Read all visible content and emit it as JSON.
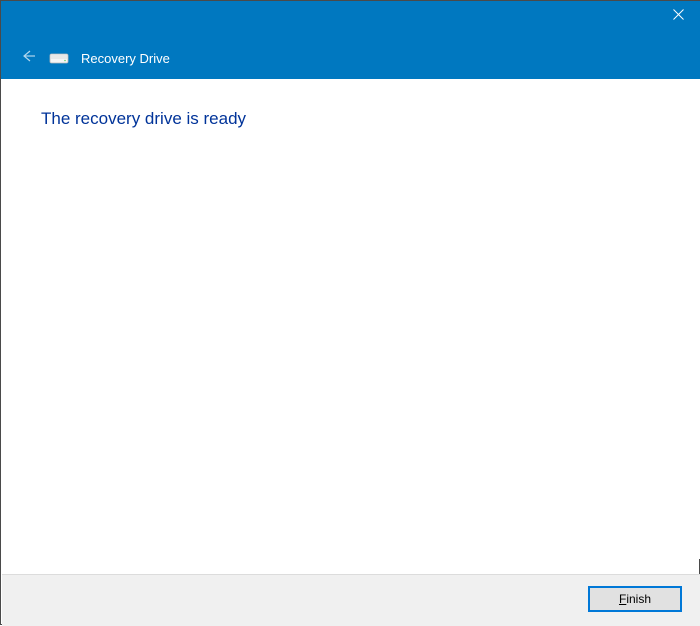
{
  "window": {
    "title": "Recovery Drive"
  },
  "content": {
    "heading": "The recovery drive is ready"
  },
  "footer": {
    "finish_label_first": "F",
    "finish_label_rest": "inish"
  },
  "icons": {
    "close": "close-icon",
    "back": "back-arrow-icon",
    "drive": "drive-icon"
  }
}
